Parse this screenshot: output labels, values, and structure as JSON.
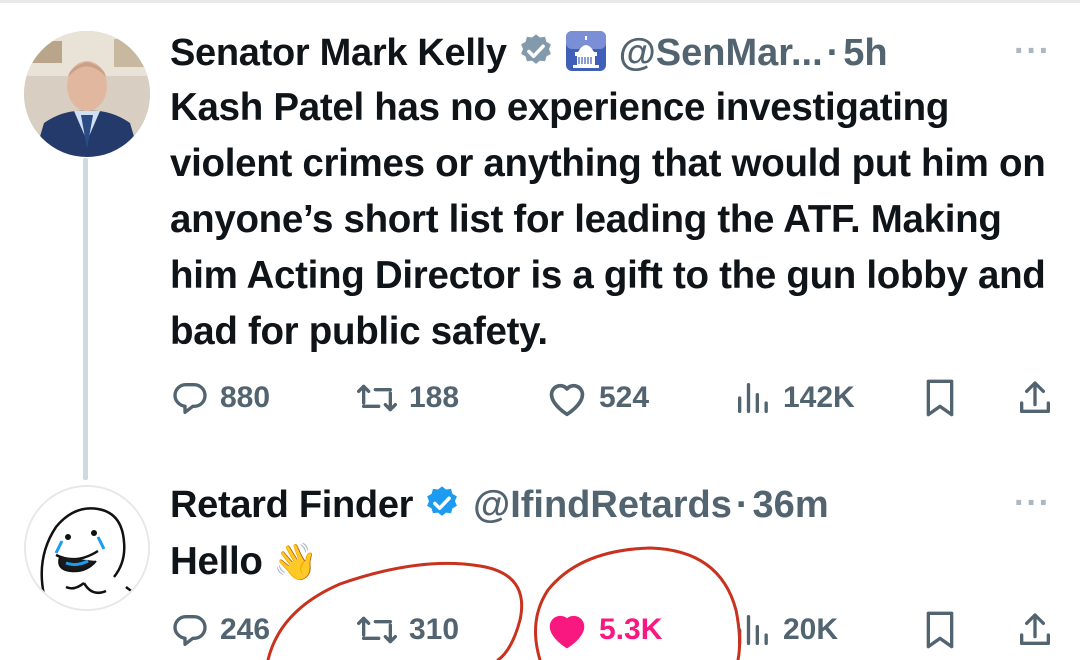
{
  "tweets": [
    {
      "display_name": "Senator Mark Kelly",
      "handle": "@SenMar...",
      "separator": "·",
      "time": "5h",
      "more": "···",
      "text": "Kash Patel has no experience investigating violent crimes or anything that would put him on anyone’s short list for leading the ATF. Making him Acting Director is a gift to the gun lobby and bad for public safety.",
      "actions": {
        "replies": "880",
        "retweets": "188",
        "likes": "524",
        "views": "142K"
      }
    },
    {
      "display_name": "Retard Finder",
      "handle": "@IfindRetards",
      "separator": "·",
      "time": "36m",
      "more": "···",
      "text": "Hello",
      "emoji": "👋",
      "actions": {
        "replies": "246",
        "retweets": "310",
        "likes": "5.3K",
        "views": "20K"
      }
    }
  ],
  "colors": {
    "verified": "#1d9bf0",
    "gov_badge": "#829aab",
    "like_active": "#f91880",
    "secondary_text": "#536471",
    "scribble": "#c8321e"
  },
  "icons": [
    "reply-icon",
    "retweet-icon",
    "like-icon",
    "views-icon",
    "bookmark-icon",
    "share-icon",
    "verified-badge-icon",
    "capitol-icon"
  ]
}
